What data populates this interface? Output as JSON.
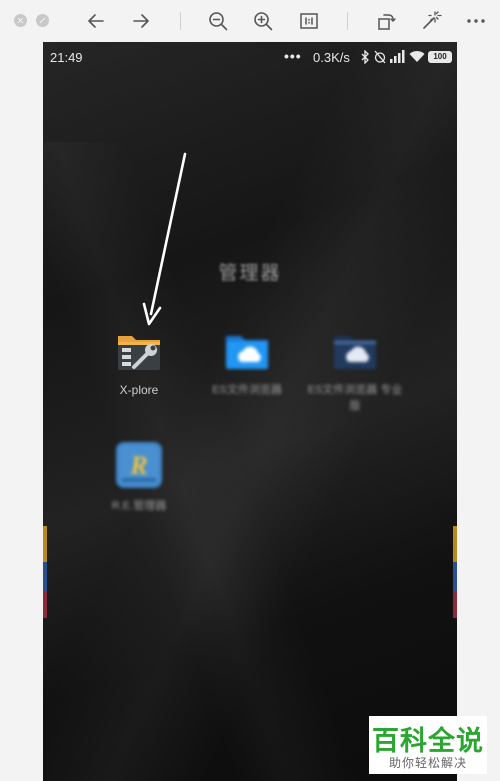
{
  "toolbar": {
    "buttons": [
      "close-icon",
      "minimize-icon",
      "back-arrow-icon",
      "forward-arrow-icon",
      "zoom-out-icon",
      "zoom-in-icon",
      "actual-size-icon",
      "rotate-icon",
      "magic-wand-icon",
      "more-icon"
    ]
  },
  "status_bar": {
    "time": "21:49",
    "more": "•••",
    "net_speed": "0.3K/s",
    "battery": "100"
  },
  "folder": {
    "title": "管理器",
    "apps": [
      {
        "label": "X-plore",
        "icon": "xplore-folder-wrench-icon"
      },
      {
        "label": "ES文件浏览器",
        "icon": "es-cloud-folder-icon"
      },
      {
        "label": "ES文件浏览器 专业版",
        "icon": "es-pro-cloud-folder-icon"
      },
      {
        "label": "R.E.管理器",
        "icon": "re-manager-icon"
      }
    ]
  },
  "watermark": {
    "main": "百科全说",
    "sub": "助你轻松解决"
  },
  "colors": {
    "watermark_green": "#2aa631",
    "toolbar_bg": "#f3f3f3",
    "es_blue": "#2196f3",
    "xplore_orange": "#e9a23b"
  }
}
